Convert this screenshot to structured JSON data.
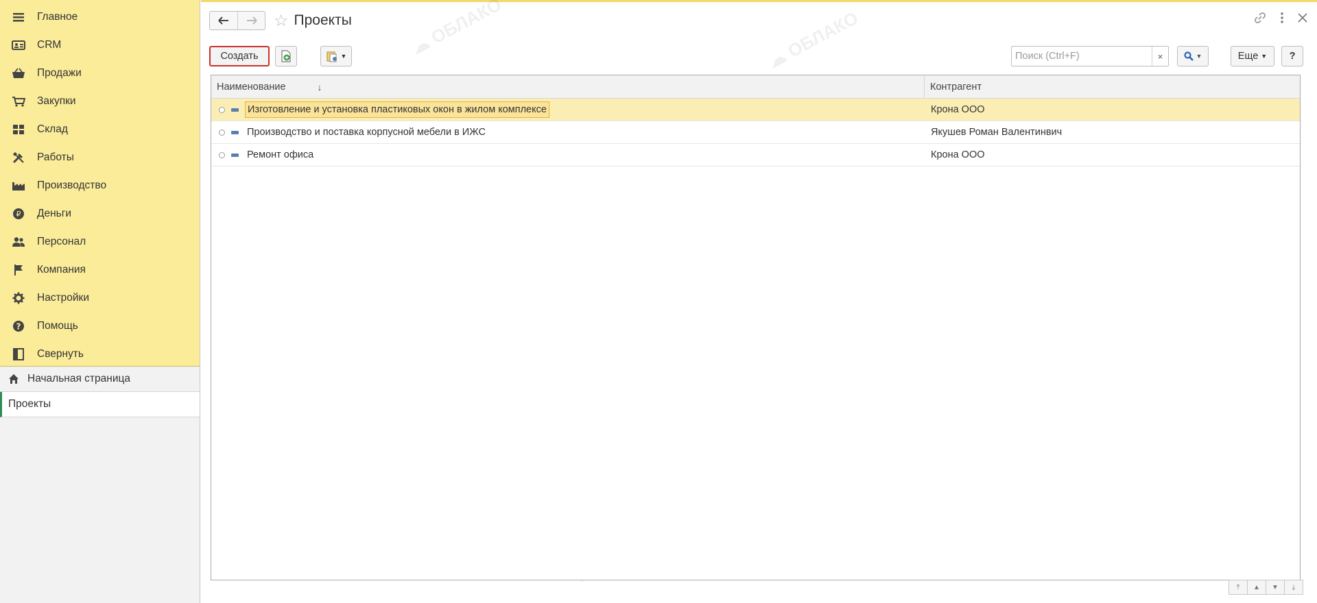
{
  "sidebar": {
    "menu": [
      {
        "label": "Главное",
        "icon": "hamburger-icon"
      },
      {
        "label": "CRM",
        "icon": "contact-card-icon"
      },
      {
        "label": "Продажи",
        "icon": "basket-icon"
      },
      {
        "label": "Закупки",
        "icon": "cart-icon"
      },
      {
        "label": "Склад",
        "icon": "warehouse-icon"
      },
      {
        "label": "Работы",
        "icon": "tools-icon"
      },
      {
        "label": "Производство",
        "icon": "factory-icon"
      },
      {
        "label": "Деньги",
        "icon": "ruble-icon"
      },
      {
        "label": "Персонал",
        "icon": "people-icon"
      },
      {
        "label": "Компания",
        "icon": "flag-icon"
      },
      {
        "label": "Настройки",
        "icon": "gear-icon"
      },
      {
        "label": "Помощь",
        "icon": "help-icon"
      },
      {
        "label": "Свернуть",
        "icon": "collapse-icon"
      }
    ],
    "home_label": "Начальная страница",
    "current_label": "Проекты"
  },
  "header": {
    "title": "Проекты"
  },
  "toolbar": {
    "create_label": "Создать",
    "search_placeholder": "Поиск (Ctrl+F)",
    "clear_label": "×",
    "more_label": "Еще",
    "help_label": "?"
  },
  "table": {
    "columns": [
      "Наименование",
      "Контрагент"
    ],
    "rows": [
      {
        "name": "Изготовление и установка пластиковых окон в жилом комплексе",
        "contractor": "Крона ООО"
      },
      {
        "name": "Производство и поставка корпусной мебели в ИЖС",
        "contractor": "Якушев Роман Валентинвич"
      },
      {
        "name": "Ремонт офиса",
        "contractor": "Крона ООО"
      }
    ]
  },
  "colors": {
    "sidebar_menu_bg": "#fbec99",
    "selected_row": "#fbeeb4",
    "create_highlight": "#c9302c",
    "current_nav_accent": "#2e8b57"
  }
}
